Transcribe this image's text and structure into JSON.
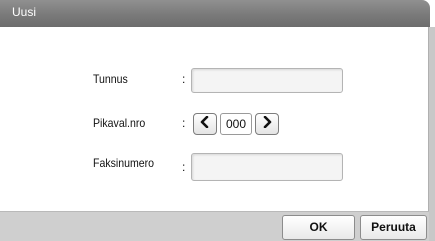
{
  "window": {
    "title": "Uusi"
  },
  "form": {
    "id_label": "Tunnus",
    "id_colon": ":",
    "id_value": "",
    "speed_dial_label": "Pikaval.nro",
    "speed_dial_colon": ":",
    "speed_dial_value": "000",
    "fax_label": "Faksinumero",
    "fax_colon": ":",
    "fax_value": ""
  },
  "footer": {
    "ok_label": "OK",
    "cancel_label": "Peruuta"
  },
  "icons": {
    "decrement": "chevron-left-icon",
    "increment": "chevron-right-icon"
  },
  "colors": {
    "titlebar": "#7a7a7a",
    "footer": "#cfcfcf"
  }
}
